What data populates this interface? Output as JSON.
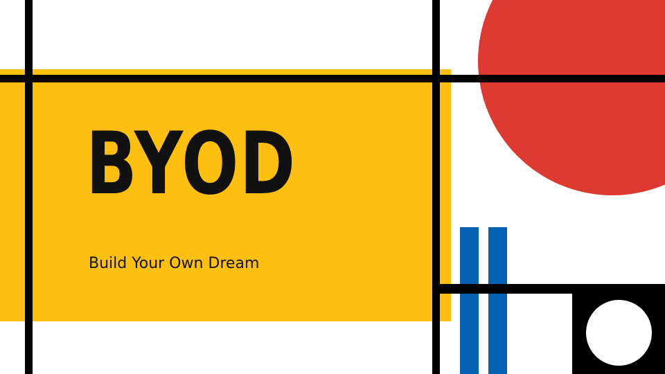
{
  "slide": {
    "title": "BYOD",
    "subtitle": "Build Your Own Dream"
  },
  "colors": {
    "yellow": "#fec010",
    "red": "#dd3a32",
    "blue": "#0561b2",
    "black": "#000000",
    "white": "#ffffff"
  }
}
